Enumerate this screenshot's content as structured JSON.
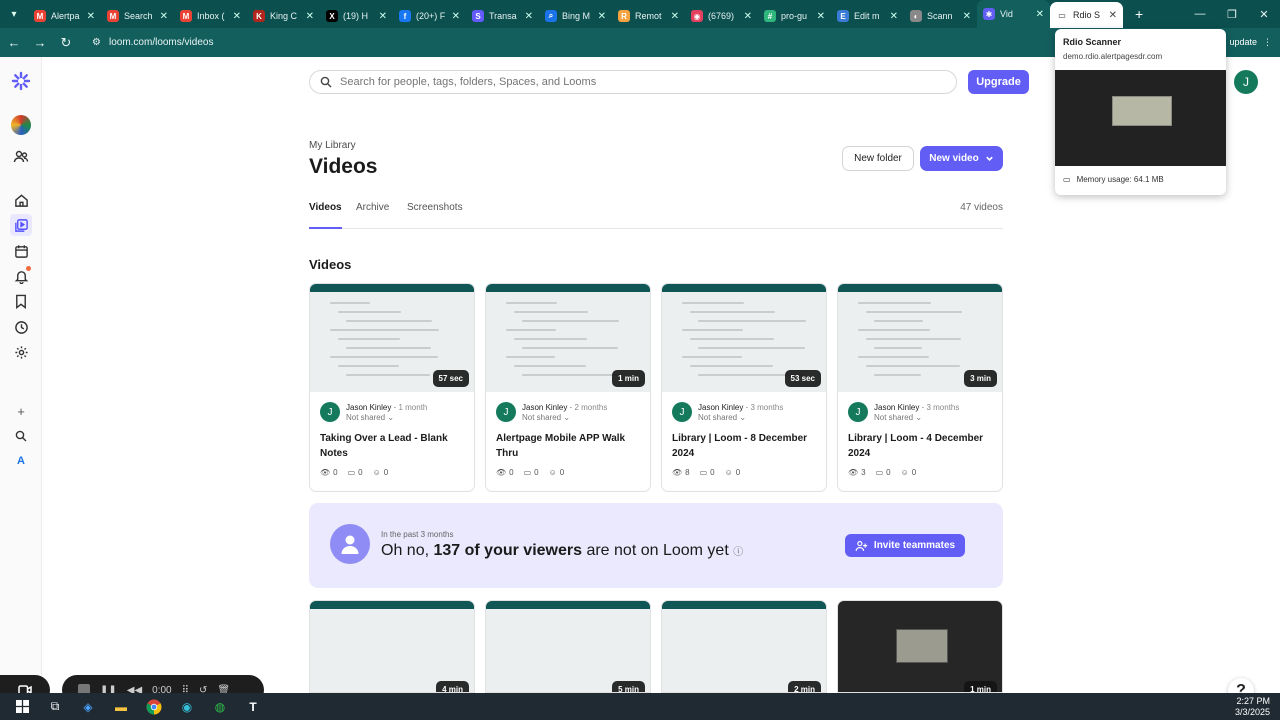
{
  "browser": {
    "tabs": [
      {
        "title": "Alertpa",
        "color": "#ea4335",
        "glyph": "M"
      },
      {
        "title": "Search",
        "color": "#ea4335",
        "glyph": "M"
      },
      {
        "title": "Inbox (",
        "color": "#ea4335",
        "glyph": "M"
      },
      {
        "title": "King C",
        "color": "#b3261e",
        "glyph": "K"
      },
      {
        "title": "(19) H",
        "color": "#000000",
        "glyph": "X"
      },
      {
        "title": "(20+) F",
        "color": "#1877f2",
        "glyph": "f"
      },
      {
        "title": "Transa",
        "color": "#635bff",
        "glyph": "S"
      },
      {
        "title": "Bing M",
        "color": "#1a73e8",
        "glyph": "⌕"
      },
      {
        "title": "Remot",
        "color": "#f4a340",
        "glyph": "R"
      },
      {
        "title": "(6769)",
        "color": "#e4405f",
        "glyph": "◉"
      },
      {
        "title": "pro-gu",
        "color": "#2eb67d",
        "glyph": "#"
      },
      {
        "title": "Edit m",
        "color": "#3a7bd5",
        "glyph": "E"
      },
      {
        "title": "Scann",
        "color": "#888888",
        "glyph": "◐"
      },
      {
        "title": "Vid",
        "color": "#625df5",
        "glyph": "✱",
        "active": true
      },
      {
        "title": "Rdio S",
        "color": "#ffffff",
        "glyph": "▭",
        "hover": true
      }
    ],
    "url": "loom.com/looms/videos",
    "update_label": "update",
    "preview": {
      "title": "Rdio Scanner",
      "url": "demo.rdio.alertpagesdr.com",
      "memory": "Memory usage: 64.1 MB"
    }
  },
  "search": {
    "placeholder": "Search for people, tags, folders, Spaces, and Looms"
  },
  "header": {
    "upgrade": "Upgrade",
    "avatar": "J"
  },
  "library": {
    "breadcrumb": "My Library",
    "title": "Videos",
    "new_folder": "New folder",
    "new_video": "New video",
    "tabs": [
      "Videos",
      "Archive",
      "Screenshots"
    ],
    "count": "47 videos",
    "section": "Videos"
  },
  "videos": [
    {
      "duration": "57 sec",
      "author": "Jason Kinley",
      "ago": "1 month",
      "sharing": "Not shared",
      "title": "Taking Over a Lead - Blank Notes",
      "views": "0",
      "comments": "0",
      "reactions": "0"
    },
    {
      "duration": "1 min",
      "author": "Jason Kinley",
      "ago": "2 months",
      "sharing": "Not shared",
      "title": "Alertpage Mobile APP Walk Thru",
      "views": "0",
      "comments": "0",
      "reactions": "0"
    },
    {
      "duration": "53 sec",
      "author": "Jason Kinley",
      "ago": "3 months",
      "sharing": "Not shared",
      "title": "Library | Loom - 8 December 2024",
      "views": "8",
      "comments": "0",
      "reactions": "0"
    },
    {
      "duration": "3 min",
      "author": "Jason Kinley",
      "ago": "3 months",
      "sharing": "Not shared",
      "title": "Library | Loom - 4 December 2024",
      "views": "3",
      "comments": "0",
      "reactions": "0"
    }
  ],
  "banner": {
    "pre": "In the past 3 months",
    "msg_start": "Oh no, ",
    "msg_bold": "137 of your viewers",
    "msg_end": " are not on Loom yet",
    "cta": "Invite teammates"
  },
  "row2_durations": [
    "4 min",
    "5 min",
    "2 min",
    "1 min"
  ],
  "recorder": {
    "time": "0:00"
  },
  "taskbar": {
    "time": "2:27 PM",
    "date": "3/3/2025"
  },
  "colors": {
    "accent": "#625df5",
    "chrome": "#135f5e",
    "avatar": "#157a5c"
  }
}
